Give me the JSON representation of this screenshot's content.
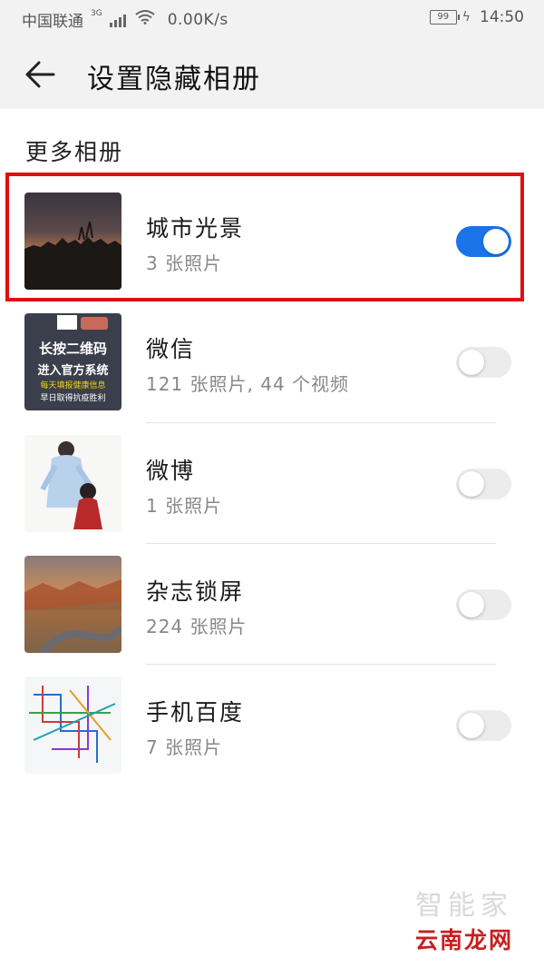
{
  "status_bar": {
    "carrier": "中国联通",
    "network": "3G",
    "speed": "0.00K/s",
    "battery": "99",
    "time": "14:50"
  },
  "header": {
    "back_icon": "arrow-left-icon",
    "title": "设置隐藏相册"
  },
  "section": {
    "title": "更多相册"
  },
  "albums": [
    {
      "name": "城市光景",
      "count": "3 张照片",
      "hidden": true
    },
    {
      "name": "微信",
      "count": "121 张照片, 44 个视频",
      "hidden": false
    },
    {
      "name": "微博",
      "count": "1 张照片",
      "hidden": false
    },
    {
      "name": "杂志锁屏",
      "count": "224 张照片",
      "hidden": false
    },
    {
      "name": "手机百度",
      "count": "7 张照片",
      "hidden": false
    }
  ],
  "thumbnail_text": {
    "wechat_line1": "长按二维码",
    "wechat_line2": "进入官方系统",
    "wechat_line3": "每天填报健康信息",
    "wechat_line4": "早日取得抗疫胜利"
  },
  "colors": {
    "toggle_on": "#1a73e8",
    "toggle_off": "#ececec",
    "highlight": "#e01010"
  },
  "watermark": {
    "top": "智能家",
    "bottom": "云南龙网"
  }
}
